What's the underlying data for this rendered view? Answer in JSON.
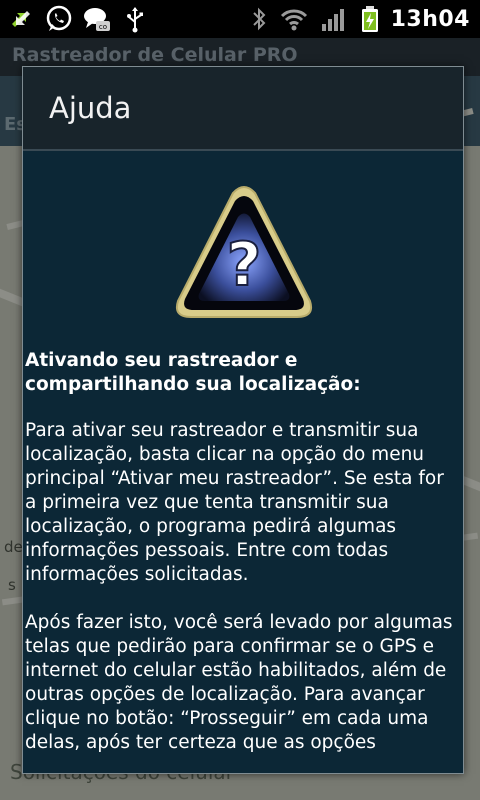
{
  "status_bar": {
    "left_icons": [
      "usb-arrows-icon",
      "whatsapp-icon",
      "chat-bubble-icon",
      "usb-icon"
    ],
    "right_icons": [
      "bluetooth-icon",
      "wifi-icon",
      "signal-icon",
      "battery-charging-icon"
    ],
    "time": "13h04"
  },
  "app": {
    "title": "Rastreador de Celular PRO",
    "tab_peek": "Es",
    "map_label_1": "de",
    "map_label_2": "s",
    "footer_peek": "Solicitações do celular"
  },
  "dialog": {
    "title": "Ajuda",
    "icon": "help-warning-icon",
    "heading": "Ativando seu rastreador e compartilhando sua localização:",
    "paragraphs": [
      "Para ativar seu rastreador e transmitir sua localização, basta clicar na opção do menu principal “Ativar meu rastreador”. Se esta for a primeira vez que tenta transmitir sua localização, o programa pedirá algumas informações pessoais. Entre com todas informações solicitadas.",
      "Após fazer isto, você será levado por algumas telas que pedirão para confirmar se o GPS e internet do celular estão habilitados, além de outras opções de localização. Para avançar clique no botão: “Prosseguir” em cada uma delas, após ter certeza que as opções"
    ]
  },
  "colors": {
    "dialog_bg": "#0c2736",
    "dialog_header_bg": "#18242b",
    "status_bar_bg": "#000000",
    "appbar_bg": "#28343b"
  }
}
